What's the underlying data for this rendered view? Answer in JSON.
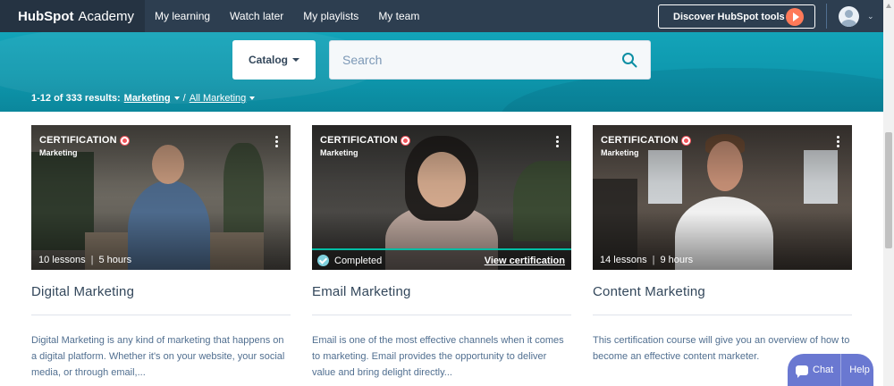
{
  "nav": {
    "logo_brand": "HubSpot",
    "logo_product": "Academy",
    "links": [
      "My learning",
      "Watch later",
      "My playlists",
      "My team"
    ],
    "discover_label": "Discover HubSpot tools"
  },
  "search": {
    "catalog_label": "Catalog",
    "placeholder": "Search",
    "results_prefix": "1-12 of 333 results:",
    "filter_primary": "Marketing",
    "filter_separator": "/",
    "filter_secondary": "All Marketing"
  },
  "cards": [
    {
      "badge": "CERTIFICATION",
      "category": "Marketing",
      "lessons": "10 lessons",
      "duration": "5 hours",
      "title": "Digital Marketing",
      "description": "Digital Marketing is any kind of marketing that happens on a digital platform. Whether it's on your website, your social media, or through email,..."
    },
    {
      "badge": "CERTIFICATION",
      "category": "Marketing",
      "status": "Completed",
      "action": "View certification",
      "progress": 1.0,
      "title": "Email Marketing",
      "description": "Email is one of the most effective channels when it comes to marketing. Email provides the opportunity to deliver value and bring delight directly..."
    },
    {
      "badge": "CERTIFICATION",
      "category": "Marketing",
      "lessons": "14 lessons",
      "duration": "9 hours",
      "title": "Content Marketing",
      "description": "This certification course will give you an overview of how to become an effective content marketer."
    }
  ],
  "chat": {
    "chat_label": "Chat",
    "help_label": "Help"
  },
  "colors": {
    "nav_bg": "#2d3e50",
    "hero_bg": "#0e97ad",
    "accent_orange": "#ff7a59",
    "cert_red": "#f2545b",
    "chat_purple": "#6a78d1"
  }
}
